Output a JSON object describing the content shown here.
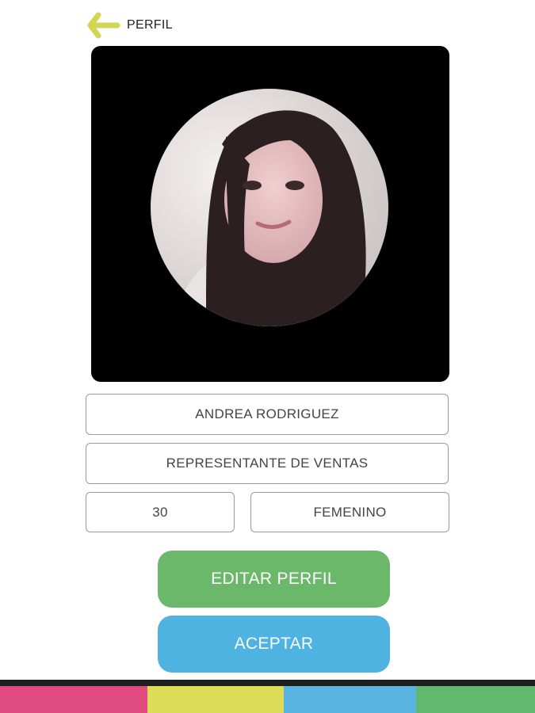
{
  "header": {
    "back_icon": "arrow-left-icon",
    "title": "PERFIL"
  },
  "colors": {
    "back_arrow": "#d2d653",
    "edit_button": "#6bb86a",
    "accept_button": "#4fb3e2",
    "bar_segments": [
      "#e04b80",
      "#dcdc58",
      "#5ab4e2",
      "#62b86c"
    ]
  },
  "profile": {
    "name": "ANDREA RODRIGUEZ",
    "role": "REPRESENTANTE DE VENTAS",
    "age": "30",
    "gender": "FEMENINO"
  },
  "actions": {
    "edit_label": "EDITAR PERFIL",
    "accept_label": "ACEPTAR"
  }
}
